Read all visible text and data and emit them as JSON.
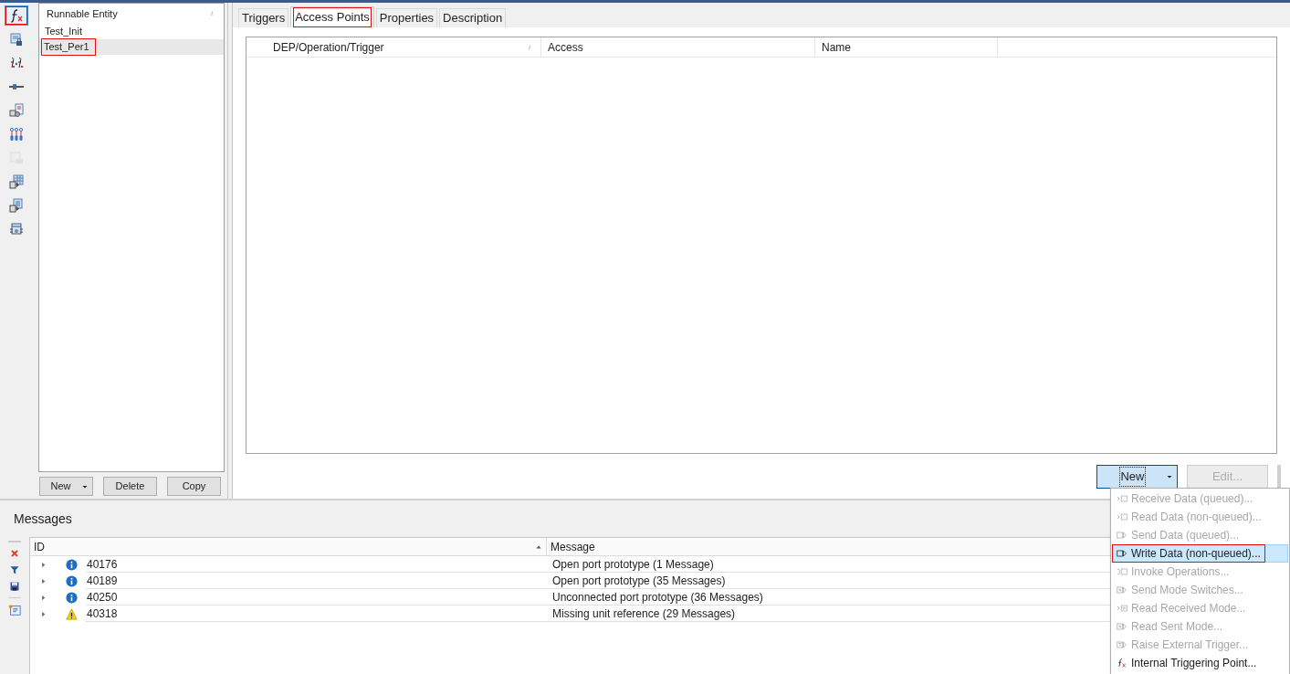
{
  "toolbar": [
    {
      "selected": true,
      "highlighted": true,
      "disabled": false
    },
    {
      "selected": false,
      "highlighted": false,
      "disabled": false
    },
    {
      "selected": false,
      "highlighted": false,
      "disabled": false
    },
    {
      "selected": false,
      "highlighted": false,
      "disabled": false
    },
    {
      "selected": false,
      "highlighted": false,
      "disabled": false
    },
    {
      "selected": false,
      "highlighted": false,
      "disabled": false
    },
    {
      "selected": false,
      "highlighted": false,
      "disabled": true
    },
    {
      "selected": false,
      "highlighted": false,
      "disabled": false
    },
    {
      "selected": false,
      "highlighted": false,
      "disabled": false
    },
    {
      "selected": false,
      "highlighted": false,
      "disabled": false
    }
  ],
  "runnables": {
    "column": "Runnable Entity",
    "items": [
      {
        "label": "Test_Init",
        "selected": false,
        "highlighted": false
      },
      {
        "label": "Test_Per1",
        "selected": true,
        "highlighted": true
      }
    ],
    "buttons": [
      {
        "label": "New",
        "dropdown": true
      },
      {
        "label": "Delete",
        "dropdown": false
      },
      {
        "label": "Copy",
        "dropdown": false
      }
    ]
  },
  "tabs": [
    {
      "label": "Triggers",
      "selected": false,
      "highlighted": false
    },
    {
      "label": "Access Points",
      "selected": true,
      "highlighted": true
    },
    {
      "label": "Properties",
      "selected": false,
      "highlighted": false
    },
    {
      "label": "Description",
      "selected": false,
      "highlighted": false
    }
  ],
  "access_table": {
    "columns": [
      "DEP/Operation/Trigger",
      "Access",
      "Name"
    ]
  },
  "actions": [
    {
      "label": "New",
      "dropdown": true,
      "disabled": false,
      "pressed": true
    },
    {
      "label": "Edit...",
      "dropdown": false,
      "disabled": true,
      "pressed": false
    }
  ],
  "new_menu": [
    {
      "label": "Receive Data (queued)...",
      "kind": "receive",
      "disabled": true,
      "selected": false,
      "highlighted": false
    },
    {
      "label": "Read Data (non-queued)...",
      "kind": "receive",
      "disabled": true,
      "selected": false,
      "highlighted": false
    },
    {
      "label": "Send Data (queued)...",
      "kind": "send",
      "disabled": true,
      "selected": false,
      "highlighted": false
    },
    {
      "label": "Write Data (non-queued)...",
      "kind": "send",
      "disabled": false,
      "selected": true,
      "highlighted": true
    },
    {
      "label": "Invoke Operations...",
      "kind": "invoke",
      "disabled": true,
      "selected": false,
      "highlighted": false
    },
    {
      "label": "Send Mode Switches...",
      "kind": "mode-send",
      "disabled": true,
      "selected": false,
      "highlighted": false
    },
    {
      "label": "Read Received Mode...",
      "kind": "mode-receive",
      "disabled": true,
      "selected": false,
      "highlighted": false
    },
    {
      "label": "Read Sent Mode...",
      "kind": "mode-send",
      "disabled": true,
      "selected": false,
      "highlighted": false
    },
    {
      "label": "Raise External Trigger...",
      "kind": "trigger",
      "disabled": true,
      "selected": false,
      "highlighted": false
    },
    {
      "label": "Internal Triggering Point...",
      "kind": "function",
      "disabled": false,
      "selected": false,
      "highlighted": false
    }
  ],
  "messages": {
    "title": "Messages",
    "columns": [
      "ID",
      "Message"
    ],
    "rows": [
      {
        "kind": "info",
        "expanded": false,
        "id": "40176",
        "message": "Open port prototype (1 Message)"
      },
      {
        "kind": "info",
        "expanded": false,
        "id": "40189",
        "message": "Open port prototype (35 Messages)"
      },
      {
        "kind": "info",
        "expanded": false,
        "id": "40250",
        "message": "Unconnected port prototype (36 Messages)"
      },
      {
        "kind": "warning",
        "expanded": false,
        "id": "40318",
        "message": "Missing unit reference (29 Messages)"
      }
    ]
  }
}
